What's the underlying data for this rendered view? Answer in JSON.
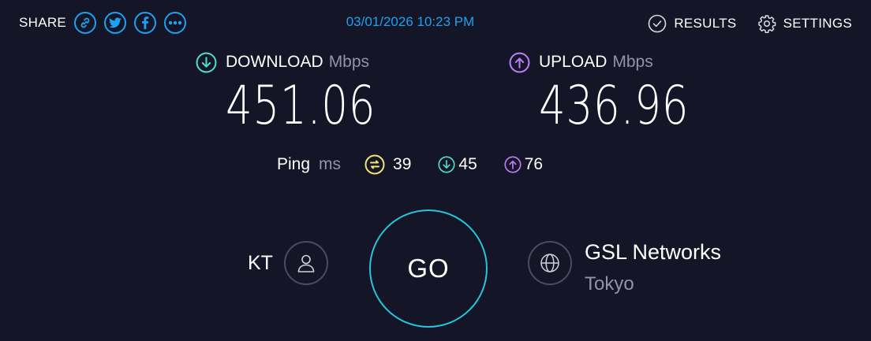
{
  "colors": {
    "background": "#141526",
    "accent_blue": "#1da1f2",
    "download_cyan": "#52d8c8",
    "upload_purple": "#b87cf4",
    "ping_yellow": "#f1e470",
    "go_ring": "#27c5da",
    "muted": "#9193a8"
  },
  "header": {
    "share_label": "SHARE",
    "share_icons": [
      "link-icon",
      "twitter-icon",
      "facebook-icon",
      "more-icon"
    ],
    "datetime": "03/01/2026 10:23 PM",
    "results_label": "RESULTS",
    "settings_label": "SETTINGS"
  },
  "download": {
    "label": "DOWNLOAD",
    "unit": "Mbps",
    "value": "451.06"
  },
  "upload": {
    "label": "UPLOAD",
    "unit": "Mbps",
    "value": "436.96"
  },
  "ping": {
    "label": "Ping",
    "unit": "ms",
    "idle": "39",
    "download": "45",
    "upload": "76"
  },
  "client": {
    "provider": "KT"
  },
  "go_label": "GO",
  "server": {
    "name": "GSL Networks",
    "location": "Tokyo"
  }
}
